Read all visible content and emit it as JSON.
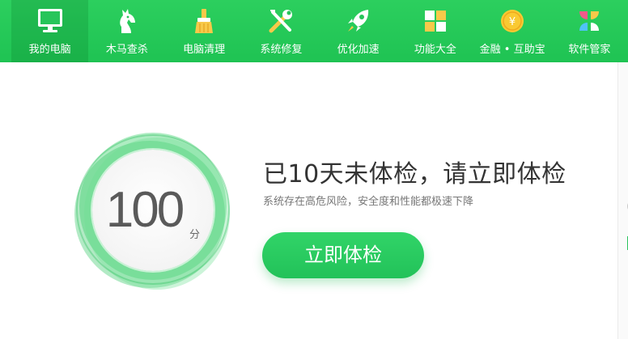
{
  "nav": {
    "items": [
      {
        "label": "我的电脑",
        "icon": "monitor-icon",
        "active": true
      },
      {
        "label": "木马查杀",
        "icon": "horse-icon",
        "active": false
      },
      {
        "label": "电脑清理",
        "icon": "broom-icon",
        "active": false
      },
      {
        "label": "系统修复",
        "icon": "wrench-screwdriver-icon",
        "active": false
      },
      {
        "label": "优化加速",
        "icon": "rocket-icon",
        "active": false
      },
      {
        "label": "功能大全",
        "icon": "grid-icon",
        "active": false
      },
      {
        "label": "金融 • 互助宝",
        "icon": "yen-coin-icon",
        "active": false
      },
      {
        "label": "软件管家",
        "icon": "petals-icon",
        "active": false
      }
    ]
  },
  "score": {
    "value": "100",
    "unit": "分"
  },
  "main": {
    "headline": "已10天未体检，请立即体检",
    "subtext": "系统存在高危风险，安全度和性能都极速下降",
    "check_button": "立即体检"
  },
  "colors": {
    "primary_green": "#2ccf5e",
    "button_green": "#31d468",
    "text_dark": "#333333",
    "text_muted": "#777777"
  }
}
